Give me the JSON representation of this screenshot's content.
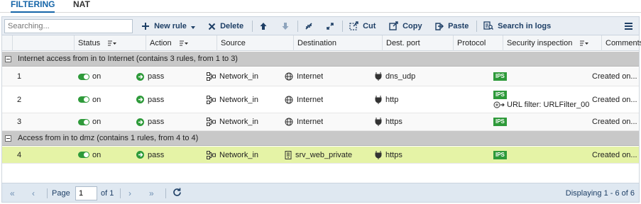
{
  "tabs": [
    {
      "label": "FILTERING",
      "active": true
    },
    {
      "label": "NAT",
      "active": false
    }
  ],
  "toolbar": {
    "search_placeholder": "Searching...",
    "new_rule": "New rule",
    "delete": "Delete",
    "cut": "Cut",
    "copy": "Copy",
    "paste": "Paste",
    "search_logs": "Search in logs"
  },
  "columns": {
    "status": "Status",
    "action": "Action",
    "source": "Source",
    "destination": "Destination",
    "dest_port": "Dest. port",
    "protocol": "Protocol",
    "security": "Security inspection",
    "comments": "Comments"
  },
  "groups": [
    {
      "title": "Internet access from in to Internet (contains 3 rules, from 1 to 3)"
    },
    {
      "title": "Access from in to dmz (contains 1 rules, from 4 to 4)"
    }
  ],
  "rows": [
    {
      "num": "1",
      "status": "on",
      "action": "pass",
      "source": "Network_in",
      "destination": "Internet",
      "dest_icon": "globe-icon",
      "port": "dns_udp",
      "protocol": "",
      "ips": "IPS",
      "url_filter": "",
      "comment": "Created on..."
    },
    {
      "num": "2",
      "status": "on",
      "action": "pass",
      "source": "Network_in",
      "destination": "Internet",
      "dest_icon": "globe-icon",
      "port": "http",
      "protocol": "",
      "ips": "IPS",
      "url_filter": "URL filter: URLFilter_00",
      "comment": "Created on..."
    },
    {
      "num": "3",
      "status": "on",
      "action": "pass",
      "source": "Network_in",
      "destination": "Internet",
      "dest_icon": "globe-icon",
      "port": "https",
      "protocol": "",
      "ips": "IPS",
      "url_filter": "",
      "comment": "Created on..."
    },
    {
      "num": "4",
      "status": "on",
      "action": "pass",
      "source": "Network_in",
      "destination": "srv_web_private",
      "dest_icon": "server-icon",
      "port": "https",
      "protocol": "",
      "ips": "IPS",
      "url_filter": "",
      "comment": "Created on..."
    }
  ],
  "footer": {
    "page_label": "Page",
    "page_value": "1",
    "of_label": "of 1",
    "displaying": "Displaying 1 - 6 of 6"
  },
  "colors": {
    "accent": "#1565a8",
    "status_on": "#2e9a3a",
    "selected_row": "#e5f3a6",
    "group_bg": "#c8c8c8"
  }
}
